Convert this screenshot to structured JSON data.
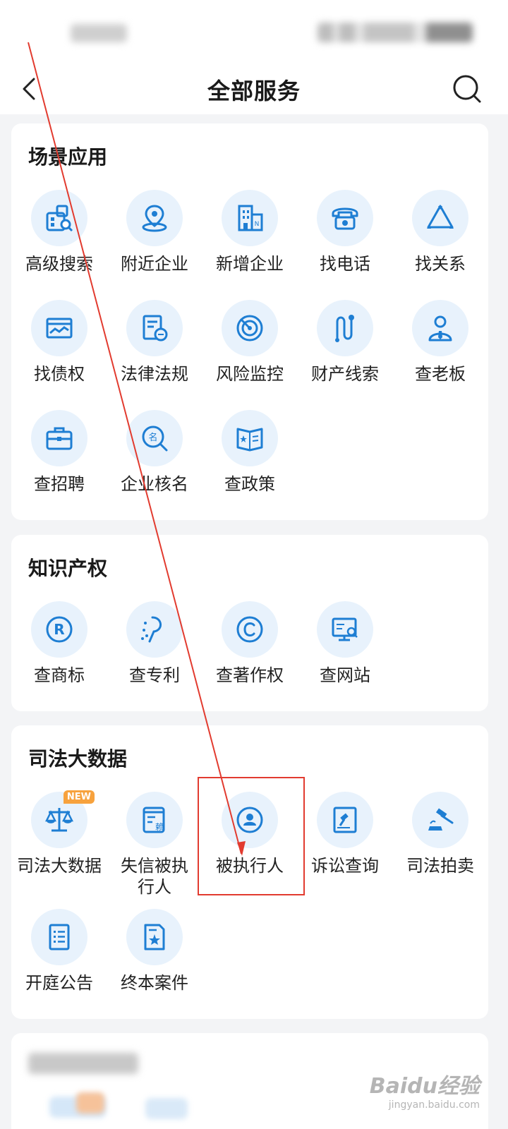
{
  "header": {
    "title": "全部服务",
    "back_icon": "back-arrow-icon",
    "search_icon": "search-icon"
  },
  "sections": [
    {
      "title": "场景应用",
      "items": [
        {
          "label": "高级搜索",
          "icon": "advanced-search-icon"
        },
        {
          "label": "附近企业",
          "icon": "nearby-location-icon"
        },
        {
          "label": "新增企业",
          "icon": "new-building-icon"
        },
        {
          "label": "找电话",
          "icon": "telephone-icon"
        },
        {
          "label": "找关系",
          "icon": "relation-triangle-icon"
        },
        {
          "label": "找债权",
          "icon": "debt-card-icon"
        },
        {
          "label": "法律法规",
          "icon": "law-document-icon"
        },
        {
          "label": "风险监控",
          "icon": "radar-icon"
        },
        {
          "label": "财产线索",
          "icon": "clue-path-icon"
        },
        {
          "label": "查老板",
          "icon": "boss-person-icon"
        },
        {
          "label": "查招聘",
          "icon": "briefcase-icon"
        },
        {
          "label": "企业核名",
          "icon": "name-check-icon"
        },
        {
          "label": "查政策",
          "icon": "policy-book-icon"
        }
      ]
    },
    {
      "title": "知识产权",
      "items": [
        {
          "label": "查商标",
          "icon": "registered-trademark-icon"
        },
        {
          "label": "查专利",
          "icon": "patent-icon"
        },
        {
          "label": "查著作权",
          "icon": "copyright-icon"
        },
        {
          "label": "查网站",
          "icon": "website-icon"
        }
      ]
    },
    {
      "title": "司法大数据",
      "items": [
        {
          "label": "司法大数据",
          "icon": "scales-icon",
          "badge": "NEW"
        },
        {
          "label": "失信被执行人",
          "icon": "dishonest-document-icon",
          "label_glyph": "赖"
        },
        {
          "label": "被执行人",
          "icon": "person-circle-icon"
        },
        {
          "label": "诉讼查询",
          "icon": "lawsuit-gavel-doc-icon"
        },
        {
          "label": "司法拍卖",
          "icon": "auction-gavel-icon"
        },
        {
          "label": "开庭公告",
          "icon": "notice-list-icon"
        },
        {
          "label": "终本案件",
          "icon": "case-star-icon"
        }
      ]
    }
  ],
  "theme": {
    "icon_color": "#1e7ed3",
    "icon_bg": "#e8f2fc",
    "badge_color": "#f7a23d",
    "highlight_color": "#e23b2f"
  },
  "watermark": {
    "brand": "Baidu经验",
    "url": "jingyan.baidu.com"
  }
}
